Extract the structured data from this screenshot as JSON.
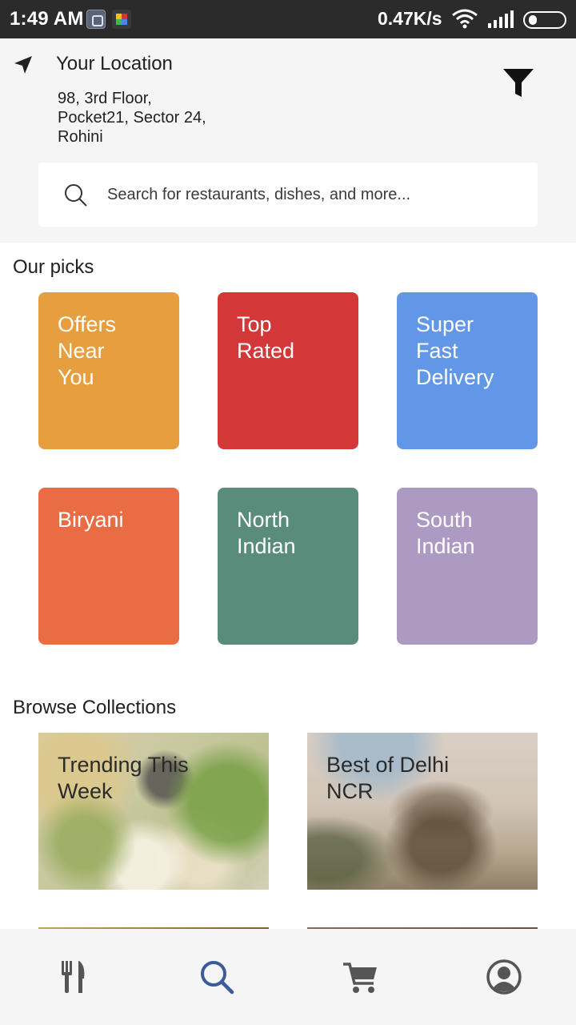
{
  "status_bar": {
    "time": "1:49 AM",
    "network_speed": "0.47K/s",
    "icons": [
      "app-notification-icon",
      "photo-app-icon",
      "wifi-icon",
      "signal-icon",
      "battery-icon"
    ]
  },
  "header": {
    "location_title": "Your Location",
    "address_lines": [
      "98, 3rd Floor,",
      "Pocket21, Sector 24,",
      "Rohini"
    ],
    "icons": [
      "location-arrow-icon",
      "filter-icon"
    ]
  },
  "search": {
    "placeholder": "Search for restaurants, dishes, and more...",
    "icon": "search-icon"
  },
  "our_picks": {
    "title": "Our picks",
    "tiles": [
      {
        "lines": [
          "Offers",
          "Near",
          "You"
        ],
        "color": "#E69E3F"
      },
      {
        "lines": [
          "Top",
          "Rated"
        ],
        "color": "#D33738"
      },
      {
        "lines": [
          "Super",
          "Fast",
          "Delivery"
        ],
        "color": "#6297E8"
      },
      {
        "lines": [
          "Biryani"
        ],
        "color": "#EA6C45"
      },
      {
        "lines": [
          "North",
          "Indian"
        ],
        "color": "#5A8C7C"
      },
      {
        "lines": [
          "South",
          "Indian"
        ],
        "color": "#AD9AC3"
      }
    ]
  },
  "browse_collections": {
    "title": "Browse Collections",
    "items": [
      {
        "lines": [
          "Trending This",
          "Week"
        ]
      },
      {
        "lines": [
          "Best of Delhi",
          "NCR"
        ]
      }
    ]
  },
  "bottom_nav": {
    "items": [
      {
        "name": "restaurants",
        "icon": "fork-knife-icon",
        "active": false
      },
      {
        "name": "search",
        "icon": "search-icon",
        "active": true
      },
      {
        "name": "cart",
        "icon": "cart-icon",
        "active": false
      },
      {
        "name": "profile",
        "icon": "profile-icon",
        "active": false
      }
    ],
    "active_color": "#3B5B9A",
    "inactive_color": "#555555"
  }
}
